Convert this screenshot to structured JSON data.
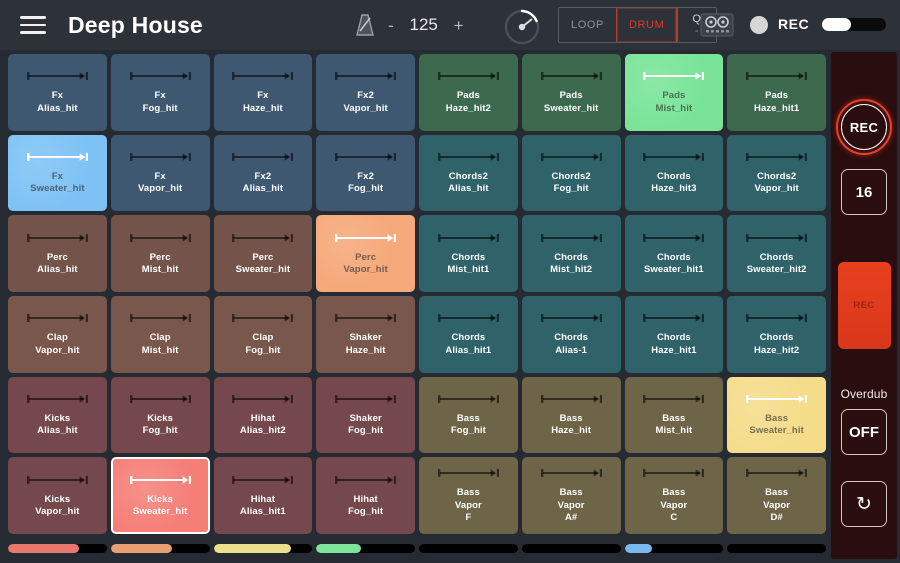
{
  "header": {
    "menu_icon": "hamburger-menu-icon",
    "project_title": "Deep House",
    "metronome_icon": "metronome-icon",
    "bpm_minus": "-",
    "bpm_value": "125",
    "bpm_plus": "+",
    "knob_icon": "rotary-knob-icon",
    "mode_loop": "LOOP",
    "mode_drum": "DRUM",
    "quantize_label": "Q",
    "quantize_value": "-",
    "drum_machine_icon": "drum-machine-icon",
    "rec_indicator_icon": "record-status-dot-icon",
    "rec_label": "REC",
    "rec_slider_value": 45,
    "accent_red": "#e03a25",
    "bar_background": "#2d3138"
  },
  "sidebar": {
    "rec_knob_label": "REC",
    "length_value": "16",
    "big_rec_label": "REC",
    "overdub_label": "Overdub",
    "overdub_value": "OFF",
    "reload_icon": "refresh-loop-icon",
    "panel_color": "#2a0d0e",
    "rec_color": "#e8401f"
  },
  "palette": {
    "fx_blue": "#3f5871",
    "fx_blue_active": "#7ec2f5",
    "pads_green": "#3d6a4f",
    "pads_green_active": "#79e498",
    "chords_teal": "#2f6269",
    "perc_brown": "#74544a",
    "perc_brown_active": "#f5a879",
    "clap_brown": "#7a574c",
    "kicks_red": "#74484c",
    "kicks_red_active": "#f57e77",
    "bass_olive": "#6e6548",
    "bass_olive_active": "#f5dc8a"
  },
  "grid": {
    "columns": 8,
    "rows": 6,
    "pads": [
      {
        "l1": "Fx",
        "l2": "Alias_hit",
        "group": "fx",
        "state": "idle"
      },
      {
        "l1": "Fx",
        "l2": "Fog_hit",
        "group": "fx",
        "state": "idle"
      },
      {
        "l1": "Fx",
        "l2": "Haze_hit",
        "group": "fx",
        "state": "idle"
      },
      {
        "l1": "Fx2",
        "l2": "Vapor_hit",
        "group": "fx",
        "state": "idle"
      },
      {
        "l1": "Pads",
        "l2": "Haze_hit2",
        "group": "pads",
        "state": "idle"
      },
      {
        "l1": "Pads",
        "l2": "Sweater_hit",
        "group": "pads",
        "state": "idle"
      },
      {
        "l1": "Pads",
        "l2": "Mist_hit",
        "group": "pads",
        "state": "active"
      },
      {
        "l1": "Pads",
        "l2": "Haze_hit1",
        "group": "pads",
        "state": "idle"
      },
      {
        "l1": "Fx",
        "l2": "Sweater_hit",
        "group": "fx",
        "state": "active"
      },
      {
        "l1": "Fx",
        "l2": "Vapor_hit",
        "group": "fx",
        "state": "idle"
      },
      {
        "l1": "Fx2",
        "l2": "Alias_hit",
        "group": "fx",
        "state": "idle"
      },
      {
        "l1": "Fx2",
        "l2": "Fog_hit",
        "group": "fx",
        "state": "idle"
      },
      {
        "l1": "Chords2",
        "l2": "Alias_hit",
        "group": "chords",
        "state": "idle"
      },
      {
        "l1": "Chords2",
        "l2": "Fog_hit",
        "group": "chords",
        "state": "idle"
      },
      {
        "l1": "Chords",
        "l2": "Haze_hit3",
        "group": "chords",
        "state": "idle"
      },
      {
        "l1": "Chords2",
        "l2": "Vapor_hit",
        "group": "chords",
        "state": "idle"
      },
      {
        "l1": "Perc",
        "l2": "Alias_hit",
        "group": "perc",
        "state": "idle"
      },
      {
        "l1": "Perc",
        "l2": "Mist_hit",
        "group": "perc",
        "state": "idle"
      },
      {
        "l1": "Perc",
        "l2": "Sweater_hit",
        "group": "perc",
        "state": "idle"
      },
      {
        "l1": "Perc",
        "l2": "Vapor_hit",
        "group": "perc",
        "state": "active"
      },
      {
        "l1": "Chords",
        "l2": "Mist_hit1",
        "group": "chords",
        "state": "idle"
      },
      {
        "l1": "Chords",
        "l2": "Mist_hit2",
        "group": "chords",
        "state": "idle"
      },
      {
        "l1": "Chords",
        "l2": "Sweater_hit1",
        "group": "chords",
        "state": "idle"
      },
      {
        "l1": "Chords",
        "l2": "Sweater_hit2",
        "group": "chords",
        "state": "idle"
      },
      {
        "l1": "Clap",
        "l2": "Vapor_hit",
        "group": "clap",
        "state": "idle"
      },
      {
        "l1": "Clap",
        "l2": "Mist_hit",
        "group": "clap",
        "state": "idle"
      },
      {
        "l1": "Clap",
        "l2": "Fog_hit",
        "group": "clap",
        "state": "idle"
      },
      {
        "l1": "Shaker",
        "l2": "Haze_hit",
        "group": "clap",
        "state": "idle"
      },
      {
        "l1": "Chords",
        "l2": "Alias_hit1",
        "group": "chords",
        "state": "idle"
      },
      {
        "l1": "Chords",
        "l2": "Alias-1",
        "group": "chords",
        "state": "idle"
      },
      {
        "l1": "Chords",
        "l2": "Haze_hit1",
        "group": "chords",
        "state": "idle"
      },
      {
        "l1": "Chords",
        "l2": "Haze_hit2",
        "group": "chords",
        "state": "idle"
      },
      {
        "l1": "Kicks",
        "l2": "Alias_hit",
        "group": "kicks",
        "state": "idle"
      },
      {
        "l1": "Kicks",
        "l2": "Fog_hit",
        "group": "kicks",
        "state": "idle"
      },
      {
        "l1": "Hihat",
        "l2": "Alias_hit2",
        "group": "kicks",
        "state": "idle"
      },
      {
        "l1": "Shaker",
        "l2": "Fog_hit",
        "group": "kicks",
        "state": "idle"
      },
      {
        "l1": "Bass",
        "l2": "Fog_hit",
        "group": "bass",
        "state": "idle"
      },
      {
        "l1": "Bass",
        "l2": "Haze_hit",
        "group": "bass",
        "state": "idle"
      },
      {
        "l1": "Bass",
        "l2": "Mist_hit",
        "group": "bass",
        "state": "idle"
      },
      {
        "l1": "Bass",
        "l2": "Sweater_hit",
        "group": "bass",
        "state": "active"
      },
      {
        "l1": "Kicks",
        "l2": "Vapor_hit",
        "group": "kicks",
        "state": "idle"
      },
      {
        "l1": "Kicks",
        "l2": "Sweater_hit",
        "group": "kicks",
        "state": "selected"
      },
      {
        "l1": "Hihat",
        "l2": "Alias_hit1",
        "group": "kicks",
        "state": "idle"
      },
      {
        "l1": "Hihat",
        "l2": "Fog_hit",
        "group": "kicks",
        "state": "idle"
      },
      {
        "l1": "Bass",
        "l2": "Vapor",
        "l3": "F",
        "group": "bass",
        "state": "idle"
      },
      {
        "l1": "Bass",
        "l2": "Vapor",
        "l3": "A#",
        "group": "bass",
        "state": "idle"
      },
      {
        "l1": "Bass",
        "l2": "Vapor",
        "l3": "C",
        "group": "bass",
        "state": "idle"
      },
      {
        "l1": "Bass",
        "l2": "Vapor",
        "l3": "D#",
        "group": "bass",
        "state": "idle"
      }
    ]
  },
  "meters": [
    {
      "percent": 72,
      "color": "#e8776e"
    },
    {
      "percent": 62,
      "color": "#e89f72"
    },
    {
      "percent": 78,
      "color": "#ece08a"
    },
    {
      "percent": 45,
      "color": "#7fe49b"
    },
    {
      "percent": 0,
      "color": "#2f6269"
    },
    {
      "percent": 0,
      "color": "#2f6269"
    },
    {
      "percent": 28,
      "color": "#7ab8ef"
    },
    {
      "percent": 0,
      "color": "#2f6269"
    }
  ]
}
